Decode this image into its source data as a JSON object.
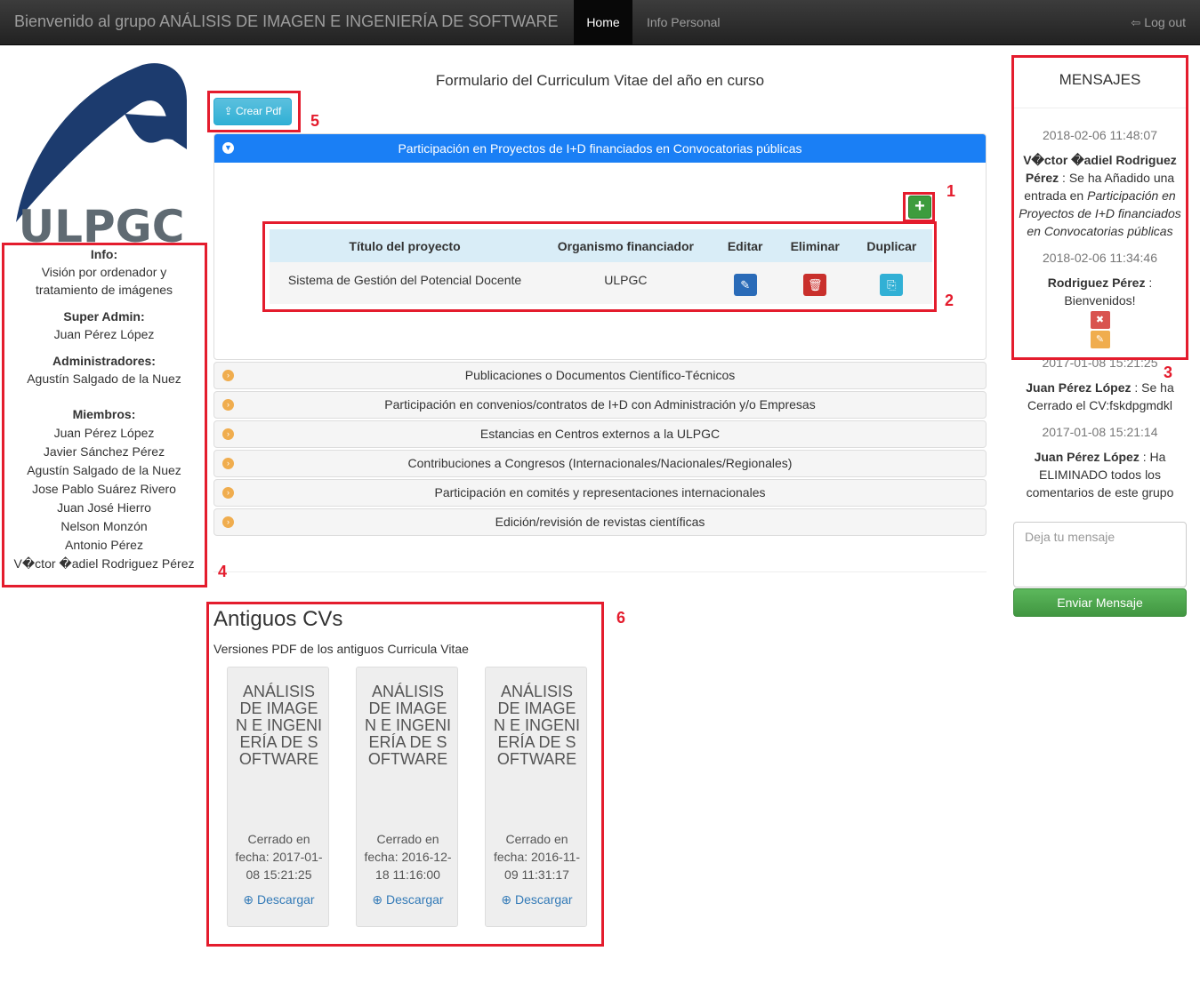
{
  "navbar": {
    "brand": "Bienvenido al grupo ANÁLISIS DE IMAGEN E INGENIERÍA DE SOFTWARE",
    "home": "Home",
    "info_personal": "Info Personal",
    "logout": "Log out"
  },
  "logo": {
    "text": "ULPGC"
  },
  "left": {
    "info_h": "Info:",
    "info_v": "Visión por ordenador y tratamiento de imágenes",
    "superadmin_h": "Super Admin:",
    "superadmin_v": "Juan Pérez López",
    "admins_h": "Administradores:",
    "admins_v": "Agustín Salgado de la Nuez",
    "members_h": "Miembros:",
    "members": [
      "Juan Pérez López",
      "Javier Sánchez Pérez",
      "Agustín Salgado de la Nuez",
      "Jose Pablo Suárez Rivero",
      "Juan José Hierro",
      "Nelson Monzón",
      "Antonio Pérez",
      "V�ctor �adiel Rodriguez Pérez"
    ]
  },
  "center": {
    "title": "Formulario del Curriculum Vitae del año en curso",
    "pdf_button": "Crear Pdf",
    "active_section": "Participación en Proyectos de I+D financiados en Convocatorias públicas",
    "add_button": "+",
    "table": {
      "headers": [
        "Título del proyecto",
        "Organismo financiador",
        "Editar",
        "Eliminar",
        "Duplicar"
      ],
      "rows": [
        {
          "titulo": "Sistema de Gestión del Potencial Docente",
          "organismo": "ULPGC"
        }
      ]
    },
    "sections": [
      "Publicaciones o Documentos Científico-Técnicos",
      "Participación en convenios/contratos de I+D con Administración y/o Empresas",
      "Estancias en Centros externos a la ULPGC",
      "Contribuciones a Congresos (Internacionales/Nacionales/Regionales)",
      "Participación en comités y representaciones internacionales",
      "Edición/revisión de revistas científicas"
    ]
  },
  "old_cvs": {
    "title": "Antiguos CVs",
    "subtitle": "Versiones PDF de los antiguos Curricula Vitae",
    "cards": [
      {
        "name": "ANÁLISIS DE IMAGEN E INGENIERÍA DE SOFTWARE",
        "date": "Cerrado en fecha: 2017-01-08 15:21:25",
        "download": "Descargar"
      },
      {
        "name": "ANÁLISIS DE IMAGEN E INGENIERÍA DE SOFTWARE",
        "date": "Cerrado en fecha: 2016-12-18 11:16:00",
        "download": "Descargar"
      },
      {
        "name": "ANÁLISIS DE IMAGEN E INGENIERÍA DE SOFTWARE",
        "date": "Cerrado en fecha: 2016-11-09 11:31:17",
        "download": "Descargar"
      }
    ]
  },
  "messages": {
    "title": "MENSAJES",
    "items": [
      {
        "date": "2018-02-06 11:48:07",
        "author": "V�ctor �adiel Rodriguez Pérez",
        "text": " : Se ha Añadido una entrada en ",
        "section": "Participación en Proyectos de I+D financiados en Convocatorias públicas"
      },
      {
        "date": "2018-02-06 11:34:46",
        "author": "Rodriguez Pérez",
        "text": " : Bienvenidos!"
      },
      {
        "date": "2017-01-08 15:21:25",
        "author": "Juan Pérez López",
        "text": " : Se ha Cerrado el CV:fskdpgmdkl"
      },
      {
        "date": "2017-01-08 15:21:14",
        "author": "Juan Pérez López",
        "text": " : Ha ELIMINADO todos los comentarios de este grupo"
      }
    ],
    "placeholder": "Deja tu mensaje",
    "send_button": "Enviar Mensaje"
  },
  "annotations": [
    "1",
    "2",
    "3",
    "4",
    "5",
    "6"
  ],
  "colors": {
    "annotation_red": "#e41c2d",
    "active_blue": "#1a7ff5",
    "accent_orange": "#f0ad4e",
    "success_green": "#5cb85c"
  },
  "icons": [
    "logout-icon",
    "pdf-export-icon",
    "collapse-circle-icon",
    "expand-circle-icon",
    "plus-icon",
    "pencil-icon",
    "trash-icon",
    "duplicate-icon",
    "download-circle-icon",
    "close-icon"
  ]
}
